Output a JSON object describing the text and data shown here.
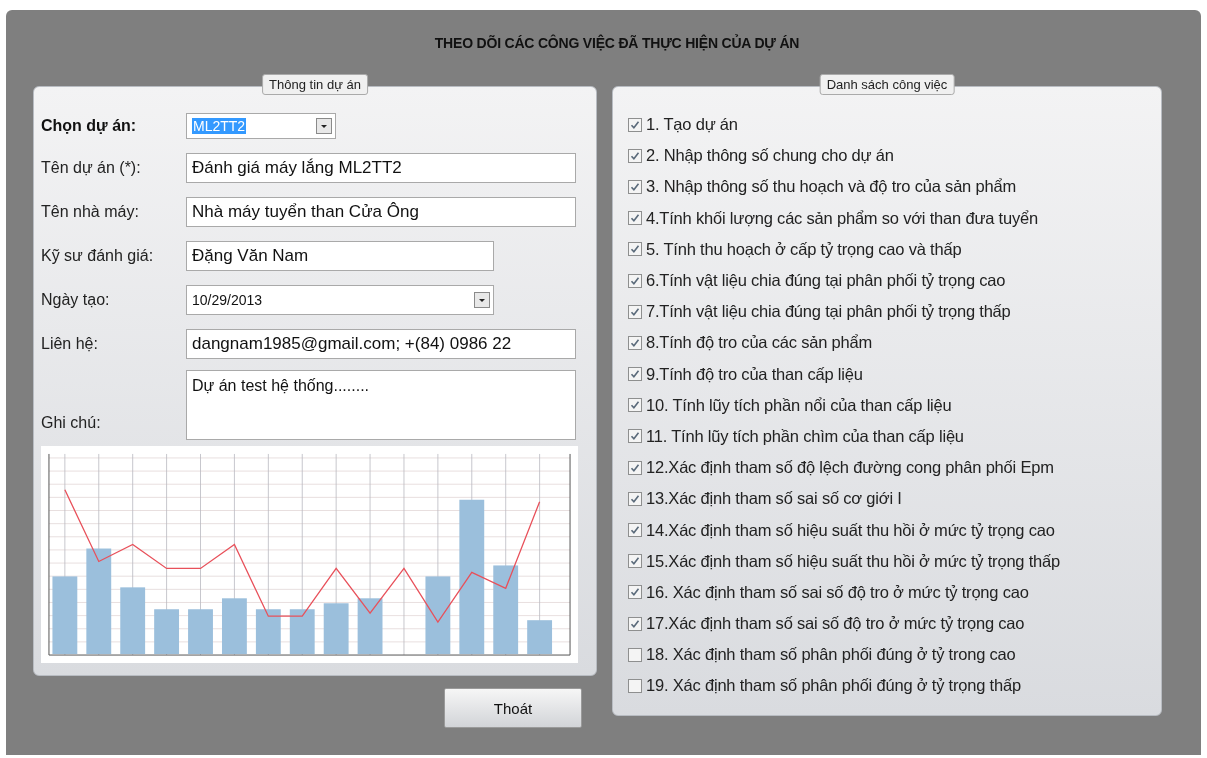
{
  "title": "THEO DÕI CÁC CÔNG VIỆC ĐÃ THỰC HIỆN CỦA DỰ ÁN",
  "project_info": {
    "legend": "Thông tin dự án",
    "fields": [
      {
        "kind": "combo",
        "label": "Chọn dự án:",
        "value": "ML2TT2"
      },
      {
        "kind": "text",
        "label": "Tên dự án (*):",
        "value": "Đánh giá máy lắng ML2TT2"
      },
      {
        "kind": "text",
        "label": "Tên nhà máy:",
        "value": "Nhà máy tuyển than Cửa Ông"
      },
      {
        "kind": "text",
        "label": "Kỹ sư đánh giá:",
        "value": "Đặng Văn Nam"
      },
      {
        "kind": "date",
        "label": "Ngày tạo:",
        "value": "10/29/2013"
      },
      {
        "kind": "text",
        "label": "Liên hệ:",
        "value": "dangnam1985@gmail.com; +(84) 0986 22"
      },
      {
        "kind": "memo",
        "label": "Ghi chú:",
        "value": "Dự án test hệ thống........"
      }
    ]
  },
  "tasks": {
    "legend": "Danh sách công việc",
    "items": [
      {
        "label": "1. Tạo dự án",
        "checked": true
      },
      {
        "label": "2. Nhập thông số chung cho dự án",
        "checked": true
      },
      {
        "label": "3. Nhập thông số thu hoạch và độ tro của sản phẩm",
        "checked": true
      },
      {
        "label": "4.Tính khối lượng các sản phẩm so với than đưa tuyển",
        "checked": true
      },
      {
        "label": "5. Tính thu hoạch ở cấp tỷ trọng cao và thấp",
        "checked": true
      },
      {
        "label": "6.Tính vật liệu chia đúng tại phân phối tỷ trọng cao",
        "checked": true
      },
      {
        "label": "7.Tính vật liệu chia đúng tại phân phối tỷ trọng thấp",
        "checked": true
      },
      {
        "label": "8.Tính độ tro của các sản phẩm",
        "checked": true
      },
      {
        "label": "9.Tính độ tro của than cấp liệu",
        "checked": true
      },
      {
        "label": "10. Tính lũy tích phần nổi của than cấp liệu",
        "checked": true
      },
      {
        "label": "11. Tính lũy tích phần chìm của than cấp liệu",
        "checked": true
      },
      {
        "label": "12.Xác định tham số độ lệch đường cong phân phối Epm",
        "checked": true
      },
      {
        "label": "13.Xác định tham số sai số cơ giới I",
        "checked": true
      },
      {
        "label": "14.Xác định tham số hiệu suất thu hồi ở mức tỷ trọng cao",
        "checked": true
      },
      {
        "label": "15.Xác định tham số hiệu suất thu hồi ở mức tỷ trọng thấp",
        "checked": true
      },
      {
        "label": "16. Xác định tham số sai số độ tro ở mức tỷ trọng cao",
        "checked": true
      },
      {
        "label": "17.Xác định tham số sai số độ tro ở mức tỷ trọng cao",
        "checked": true
      },
      {
        "label": "18. Xác định tham số phân phối đúng ở tỷ trong cao",
        "checked": false
      },
      {
        "label": "19. Xác định tham số phân phối đúng ở tỷ trọng thấp",
        "checked": false
      }
    ]
  },
  "buttons": [
    {
      "label": "Thoát"
    }
  ]
}
